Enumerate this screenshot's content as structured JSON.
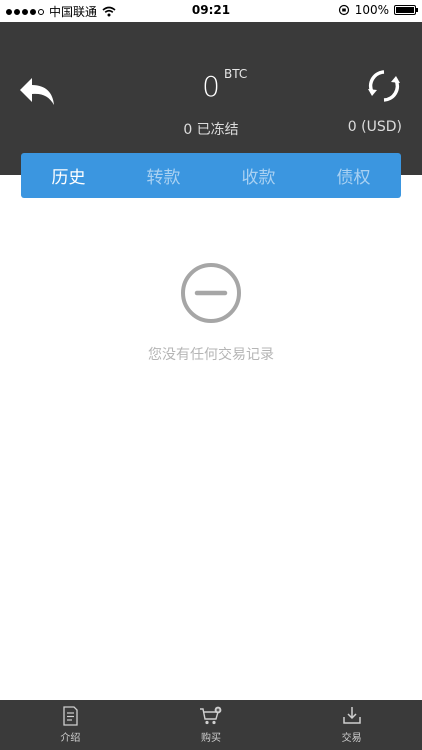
{
  "status_bar": {
    "carrier": "中国联通",
    "time": "09:21",
    "battery": "100%"
  },
  "balance": {
    "amount": "0",
    "unit": "BTC",
    "frozen": "0 已冻结",
    "usd": "0 (USD)"
  },
  "tabs": [
    {
      "label": "历史",
      "active": true
    },
    {
      "label": "转款",
      "active": false
    },
    {
      "label": "收款",
      "active": false
    },
    {
      "label": "债权",
      "active": false
    }
  ],
  "empty_state": {
    "message": "您没有任何交易记录",
    "icon": "minus-circle-icon"
  },
  "bottom_nav": [
    {
      "label": "介绍",
      "icon": "document-icon"
    },
    {
      "label": "购买",
      "icon": "cart-icon"
    },
    {
      "label": "交易",
      "icon": "download-tray-icon"
    }
  ],
  "colors": {
    "header_bg": "#3a3a3a",
    "tab_bar_bg": "#3b96e0",
    "tab_active": "#ffffff",
    "tab_inactive": "#a9d1f2"
  }
}
